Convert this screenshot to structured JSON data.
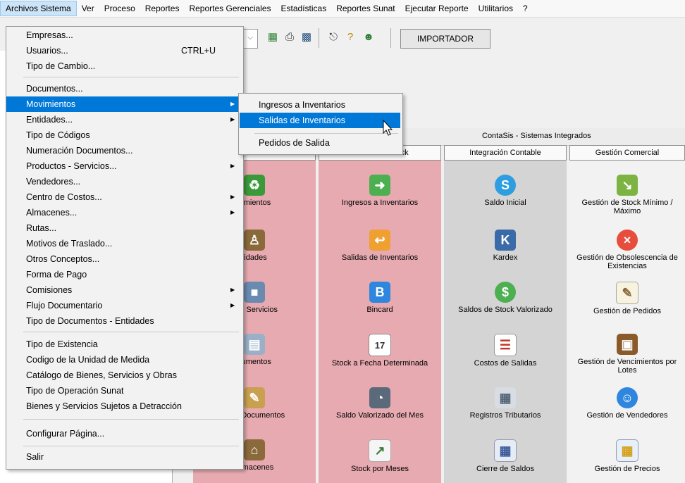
{
  "menubar": [
    "Archivos Sistema",
    "Ver",
    "Proceso",
    "Reportes",
    "Reportes Gerenciales",
    "Estadísticas",
    "Reportes Sunat",
    "Ejecutar Reporte",
    "Utilitarios",
    "?"
  ],
  "toolbar": {
    "importer_label": "IMPORTADOR"
  },
  "file_menu": {
    "items": [
      {
        "label": "Empresas..."
      },
      {
        "label": "Usuarios...",
        "shortcut": "CTRL+U"
      },
      {
        "label": "Tipo de Cambio..."
      },
      {
        "label": "Documentos..."
      },
      {
        "label": "Movimientos"
      },
      {
        "label": "Entidades..."
      },
      {
        "label": "Tipo de Códigos"
      },
      {
        "label": "Numeración Documentos..."
      },
      {
        "label": "Productos - Servicios..."
      },
      {
        "label": "Vendedores..."
      },
      {
        "label": "Centro de Costos..."
      },
      {
        "label": "Almacenes..."
      },
      {
        "label": "Rutas..."
      },
      {
        "label": "Motivos de Traslado..."
      },
      {
        "label": "Otros Conceptos..."
      },
      {
        "label": "Forma de Pago"
      },
      {
        "label": "Comisiones"
      },
      {
        "label": "Flujo Documentario"
      },
      {
        "label": "Tipo de Documentos - Entidades"
      },
      {
        "label": "Tipo de Existencia"
      },
      {
        "label": "Codigo de la Unidad de Medida"
      },
      {
        "label": "Catálogo de Bienes, Servicios y Obras"
      },
      {
        "label": "Tipo de Operación Sunat"
      },
      {
        "label": "Bienes y Servicios Sujetos a Detracción"
      },
      {
        "label": "Configurar Página..."
      },
      {
        "label": "Salir"
      }
    ]
  },
  "submenu": {
    "items": [
      {
        "label": "Ingresos a Inventarios"
      },
      {
        "label": "Salidas de Inventarios"
      },
      {
        "label": "Pedidos de Salida"
      }
    ]
  },
  "main": {
    "title": "ContaSis - Sistemas Integrados",
    "columns": [
      {
        "header": "rametros",
        "tiles": [
          "vimientos",
          "tidades",
          "os - Servicios",
          "cumentos",
          "n de Documentos",
          "Almacenes"
        ]
      },
      {
        "header": "Control de Stock",
        "tiles": [
          "Ingresos a Inventarios",
          "Salidas de Inventarios",
          "Bincard",
          "Stock a Fecha Determinada",
          "Saldo Valorizado del Mes",
          "Stock por Meses"
        ]
      },
      {
        "header": "Integración Contable",
        "tiles": [
          "Saldo Inicial",
          "Kardex",
          "Saldos de Stock Valorizado",
          "Costos de Salidas",
          "Registros Tributarios",
          "Cierre de Saldos"
        ]
      },
      {
        "header": "Gestión Comercial",
        "tiles": [
          "Gestión de Stock Mínimo / Máximo",
          "Gestión de Obsolescencia de Existencias",
          "Gestión de Pedidos",
          "Gestión de Vencimientos por Lotes",
          "Gestión de Vendedores",
          "Gestión de Precios"
        ]
      }
    ]
  }
}
